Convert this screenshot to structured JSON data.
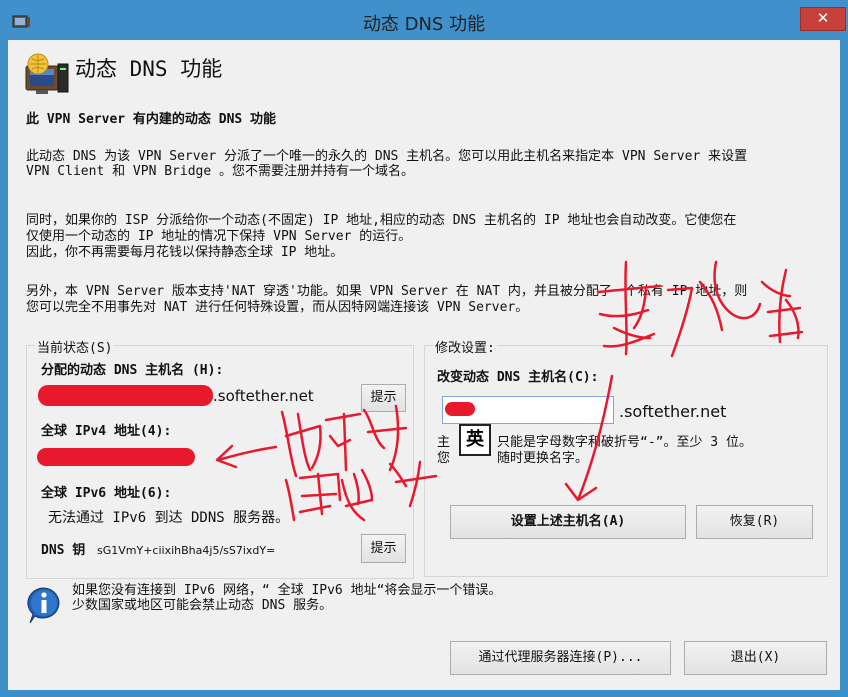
{
  "window": {
    "title": "动态 DNS 功能",
    "close_label": "✕"
  },
  "header": {
    "title": "动态 DNS 功能"
  },
  "intro": {
    "heading": "此 VPN Server 有内建的动态 DNS 功能",
    "para1_line1": "此动态 DNS 为该 VPN Server 分派了一个唯一的永久的 DNS 主机名。您可以用此主机名来指定本 VPN Server 来设置",
    "para1_line2": "VPN Client 和 VPN Bridge 。您不需要注册并持有一个域名。",
    "para2_line1": "同时，如果你的 ISP 分派给你一个动态(不固定) IP 地址,相应的动态 DNS 主机名的 IP 地址也会自动改变。它使您在",
    "para2_line2": "仅使用一个动态的 IP 地址的情况下保持 VPN Server 的运行。",
    "para2_line3": "因此，你不再需要每月花钱以保持静态全球 IP 地址。",
    "para3_line1": "另外，本 VPN Server 版本支持'NAT 穿透'功能。如果 VPN Server 在 NAT 内，并且被分配了一个私有 IP 地址，则",
    "para3_line2": "您可以完全不用事先对 NAT 进行任何特殊设置，而从因特网端连接该 VPN Server。"
  },
  "current_status": {
    "group_label": "当前状态(S)",
    "hostname_label": "分配的动态 DNS 主机名 (H):",
    "hostname_suffix": ".softether.net",
    "hint_button": "提示",
    "ipv4_label": "全球 IPv4 地址(4):",
    "ipv6_label": "全球 IPv6 地址(6):",
    "ipv6_value": "无法通过 IPv6 到达 DDNS 服务器。",
    "dns_key_label": "DNS 钥",
    "dns_key_value": "sG1VmY+ciixihBha4j5/sS7ixdY=",
    "hint_button_2": "提示"
  },
  "modify": {
    "group_label": "修改设置:",
    "change_label": "改变动态 DNS 主机名(C):",
    "suffix": ".softether.net",
    "ime_badge": "英",
    "help_line1": "只能是字母数字和破折号“-”。至少 3 位。",
    "help_line2": "随时更换名字。",
    "help_prefix1": "主",
    "help_prefix2": "您",
    "set_button": "设置上述主机名(A)",
    "restore_button": "恢复(R)"
  },
  "info": {
    "line1": "如果您没有连接到 IPv6 网络，“ 全球 IPv6 地址“将会显示一个错误。",
    "line2": "少数国家或地区可能会禁止动态 DNS 服务。"
  },
  "footer": {
    "proxy_button": "通过代理服务器连接(P)...",
    "exit_button": "退出(X)"
  },
  "colors": {
    "redaction": "#e8192c",
    "titlebar": "#3f90cb",
    "close": "#c7413a"
  }
}
